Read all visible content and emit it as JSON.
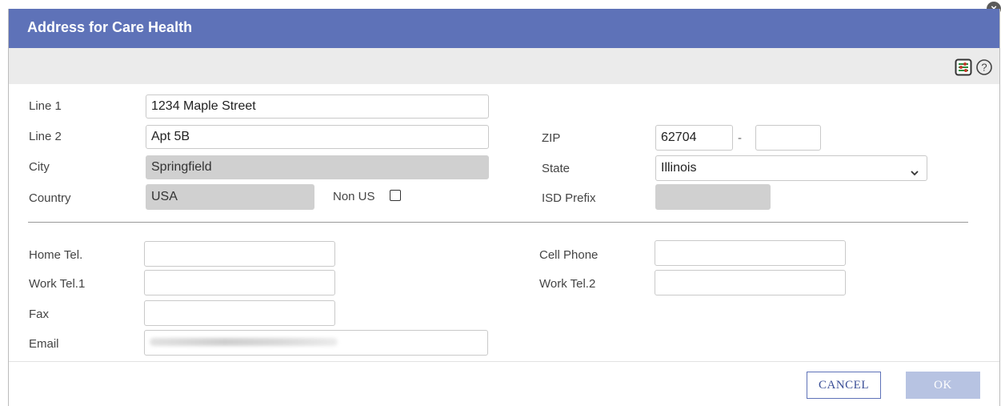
{
  "dialog": {
    "title": "Address for Care Health"
  },
  "toolbar": {
    "settings_icon": "settings-sliders-icon",
    "help_icon": "help-icon"
  },
  "address": {
    "line1_label": "Line 1",
    "line1_value": "1234 Maple Street",
    "line2_label": "Line 2",
    "line2_value": "Apt 5B",
    "city_label": "City",
    "city_value": "Springfield",
    "country_label": "Country",
    "country_value": "USA",
    "non_us_label": "Non US",
    "non_us_checked": false,
    "zip_label": "ZIP",
    "zip_value": "62704",
    "zip_separator": "-",
    "zip_ext_value": "",
    "state_label": "State",
    "state_value": "Illinois",
    "isd_label": "ISD Prefix",
    "isd_value": ""
  },
  "contact": {
    "home_tel_label": "Home Tel.",
    "home_tel_value": "",
    "work_tel1_label": "Work Tel.1",
    "work_tel1_value": "",
    "fax_label": "Fax",
    "fax_value": "",
    "email_label": "Email",
    "email_value_blurred": true,
    "cell_phone_label": "Cell Phone",
    "cell_phone_value": "",
    "work_tel2_label": "Work Tel.2",
    "work_tel2_value": ""
  },
  "buttons": {
    "cancel_label": "CANCEL",
    "ok_label": "OK"
  },
  "colors": {
    "titlebar": "#5e72b8",
    "toolbar": "#ebebeb",
    "readonly_field": "#d0d0d0",
    "ok_disabled": "#b7c3e2"
  }
}
